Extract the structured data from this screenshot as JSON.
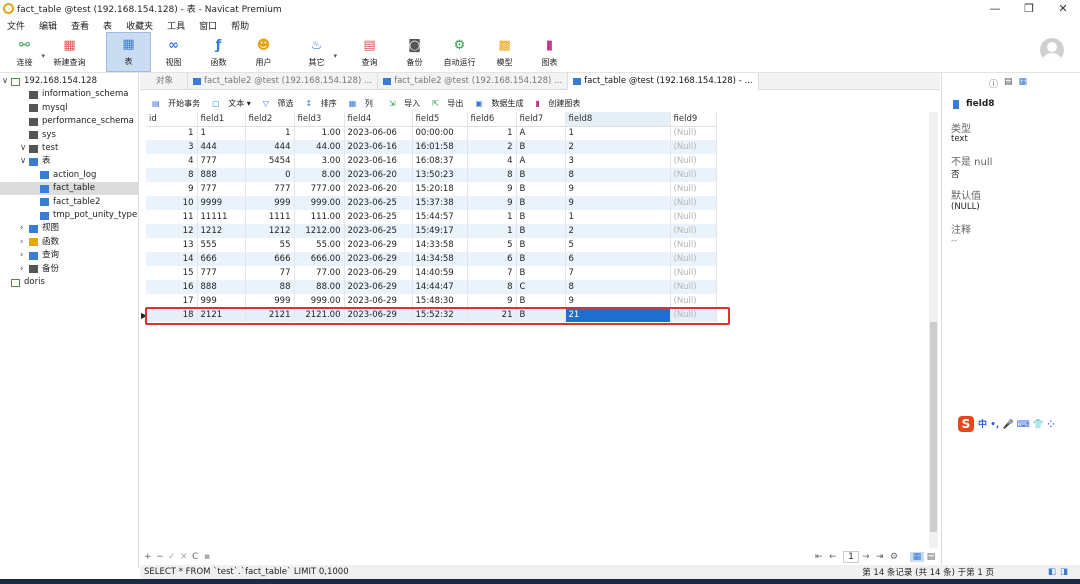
{
  "window": {
    "title": "fact_table @test (192.168.154.128) - 表 - Navicat Premium",
    "min": "—",
    "max": "❐",
    "close": "✕"
  },
  "menu": [
    "文件",
    "编辑",
    "查看",
    "表",
    "收藏夹",
    "工具",
    "窗口",
    "帮助"
  ],
  "toolbar": [
    {
      "label": "连接",
      "icon": "connection-icon",
      "color": "#2e9c4a"
    },
    {
      "label": "新建查询",
      "icon": "new-query-icon",
      "color": "#d9534f"
    },
    {
      "label": "表",
      "icon": "table-icon",
      "color": "#3a7bd5"
    },
    {
      "label": "视图",
      "icon": "view-icon",
      "color": "#3a7bd5"
    },
    {
      "label": "函数",
      "icon": "function-icon",
      "color": "#3a7bd5"
    },
    {
      "label": "用户",
      "icon": "user-icon",
      "color": "#e8a317"
    },
    {
      "label": "其它",
      "icon": "other-icon",
      "color": "#3a7bd5"
    },
    {
      "label": "查询",
      "icon": "query-icon",
      "color": "#d9534f"
    },
    {
      "label": "备份",
      "icon": "backup-icon",
      "color": "#555555"
    },
    {
      "label": "自动运行",
      "icon": "automation-icon",
      "color": "#2e9c4a"
    },
    {
      "label": "模型",
      "icon": "model-icon",
      "color": "#e8a317"
    },
    {
      "label": "图表",
      "icon": "chart-icon",
      "color": "#c2378f"
    }
  ],
  "nav": [
    {
      "label": "192.168.154.128",
      "icon": "server-icon",
      "level": 0,
      "arrow": "∨"
    },
    {
      "label": "information_schema",
      "icon": "database-icon",
      "level": 1
    },
    {
      "label": "mysql",
      "icon": "database-icon",
      "level": 1
    },
    {
      "label": "performance_schema",
      "icon": "database-icon",
      "level": 1
    },
    {
      "label": "sys",
      "icon": "database-icon",
      "level": 1
    },
    {
      "label": "test",
      "icon": "database-icon",
      "level": 1,
      "arrow": "∨"
    },
    {
      "label": "表",
      "icon": "tables-icon",
      "level": 2,
      "arrow": "∨"
    },
    {
      "label": "action_log",
      "icon": "table-icon",
      "level": 3
    },
    {
      "label": "fact_table",
      "icon": "table-icon",
      "level": 3,
      "selected": true
    },
    {
      "label": "fact_table2",
      "icon": "table-icon",
      "level": 3
    },
    {
      "label": "tmp_pot_unity_type",
      "icon": "table-icon",
      "level": 3
    },
    {
      "label": "视图",
      "icon": "views-icon",
      "level": 2,
      "arrow": "›"
    },
    {
      "label": "函数",
      "icon": "functions-icon",
      "level": 2,
      "arrow": "›"
    },
    {
      "label": "查询",
      "icon": "queries-icon",
      "level": 2,
      "arrow": "›"
    },
    {
      "label": "备份",
      "icon": "backups-icon",
      "level": 2,
      "arrow": "›"
    },
    {
      "label": "doris",
      "icon": "server-icon",
      "level": 0
    }
  ],
  "tabs": [
    {
      "label": "对象",
      "active": false,
      "icon": false
    },
    {
      "label": "fact_table2 @test (192.168.154.128) ...",
      "active": false,
      "icon": true
    },
    {
      "label": "fact_table2 @test (192.168.154.128) ...",
      "active": false,
      "icon": true
    },
    {
      "label": "fact_table @test (192.168.154.128) - ...",
      "active": true,
      "icon": true
    }
  ],
  "subtoolbar": [
    "开始事务",
    "文本 ▾",
    "筛选",
    "排序",
    "列",
    "导入",
    "导出",
    "数据生成",
    "创建图表"
  ],
  "columns": [
    "id",
    "field1",
    "field2",
    "field3",
    "field4",
    "field5",
    "field6",
    "field7",
    "field8",
    "field9"
  ],
  "rows": [
    [
      "1",
      "1",
      "1",
      "1.00",
      "2023-06-06",
      "00:00:00",
      "1",
      "A",
      "1",
      "(Null)"
    ],
    [
      "3",
      "444",
      "444",
      "44.00",
      "2023-06-16",
      "16:01:58",
      "2",
      "B",
      "2",
      "(Null)"
    ],
    [
      "4",
      "777",
      "5454",
      "3.00",
      "2023-06-16",
      "16:08:37",
      "4",
      "A",
      "3",
      "(Null)"
    ],
    [
      "8",
      "888",
      "0",
      "8.00",
      "2023-06-20",
      "13:50:23",
      "8",
      "B",
      "8",
      "(Null)"
    ],
    [
      "9",
      "777",
      "777",
      "777.00",
      "2023-06-20",
      "15:20:18",
      "9",
      "B",
      "9",
      "(Null)"
    ],
    [
      "10",
      "9999",
      "999",
      "999.00",
      "2023-06-25",
      "15:37:38",
      "9",
      "B",
      "9",
      "(Null)"
    ],
    [
      "11",
      "11111",
      "1111",
      "111.00",
      "2023-06-25",
      "15:44:57",
      "1",
      "B",
      "1",
      "(Null)"
    ],
    [
      "12",
      "1212",
      "1212",
      "1212.00",
      "2023-06-25",
      "15:49:17",
      "1",
      "B",
      "2",
      "(Null)"
    ],
    [
      "13",
      "555",
      "55",
      "55.00",
      "2023-06-29",
      "14:33:58",
      "5",
      "B",
      "5",
      "(Null)"
    ],
    [
      "14",
      "666",
      "666",
      "666.00",
      "2023-06-29",
      "14:34:58",
      "6",
      "B",
      "6",
      "(Null)"
    ],
    [
      "15",
      "777",
      "77",
      "77.00",
      "2023-06-29",
      "14:40:59",
      "7",
      "B",
      "7",
      "(Null)"
    ],
    [
      "16",
      "888",
      "88",
      "88.00",
      "2023-06-29",
      "14:44:47",
      "8",
      "C",
      "8",
      "(Null)"
    ],
    [
      "17",
      "999",
      "999",
      "999.00",
      "2023-06-29",
      "15:48:30",
      "9",
      "B",
      "9",
      "(Null)"
    ],
    [
      "18",
      "2121",
      "2121",
      "2121.00",
      "2023-06-29",
      "15:52:32",
      "21",
      "B",
      "21",
      "(Null)"
    ]
  ],
  "row_marker": "▶",
  "bottom_controls": [
    "+",
    "−",
    "✓",
    "✕",
    "C",
    "▪"
  ],
  "pager": {
    "first": "⇤",
    "prev": "←",
    "page": "1",
    "next": "→",
    "last": "⇥",
    "settings": "⚙"
  },
  "status": {
    "sql": "SELECT * FROM `test`.`fact_table` LIMIT 0,1000",
    "records": "第 14 条记录 (共 14 条) 于第 1 页"
  },
  "right_panel": {
    "field_name": "field8",
    "type_label": "类型",
    "type_value": "text",
    "notnull_label": "不是 null",
    "notnull_value": "否",
    "default_label": "默认值",
    "default_value": "(NULL)",
    "comment_label": "注释",
    "comment_value": "--"
  },
  "ime": {
    "text": "中 •, 🎤 ⌨ 👕 ⁘"
  },
  "colors": {
    "accent": "#1f6fd0",
    "highlight_border": "#d93232",
    "selected_nav": "#dcdcdc",
    "alt_row": "#eaf2fb"
  }
}
